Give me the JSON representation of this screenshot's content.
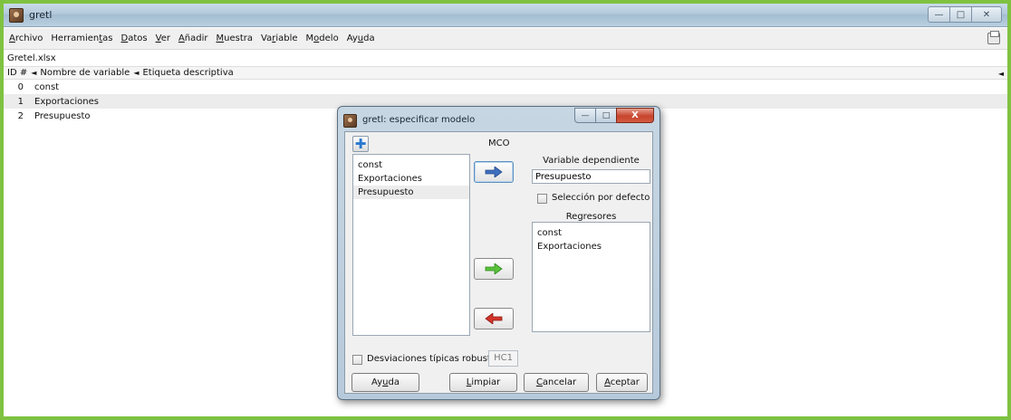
{
  "window": {
    "title": "gretl",
    "controls": {
      "minimize": "—",
      "maximize": "□",
      "close": "✕"
    }
  },
  "menubar": {
    "items": [
      {
        "pre": "",
        "key": "A",
        "post": "rchivo"
      },
      {
        "pre": "Herramien",
        "key": "t",
        "post": "as"
      },
      {
        "pre": "",
        "key": "D",
        "post": "atos"
      },
      {
        "pre": "",
        "key": "V",
        "post": "er"
      },
      {
        "pre": "",
        "key": "A",
        "post": "ñadir"
      },
      {
        "pre": "",
        "key": "M",
        "post": "uestra"
      },
      {
        "pre": "Va",
        "key": "r",
        "post": "iable"
      },
      {
        "pre": "M",
        "key": "o",
        "post": "delo"
      },
      {
        "pre": "Ay",
        "key": "u",
        "post": "da"
      }
    ]
  },
  "file": {
    "name": "Gretel.xlsx"
  },
  "table": {
    "headers": {
      "id": "ID #",
      "name": "Nombre de variable",
      "label": "Etiqueta descriptiva"
    },
    "rows": [
      {
        "id": "0",
        "name": "const"
      },
      {
        "id": "1",
        "name": "Exportaciones"
      },
      {
        "id": "2",
        "name": "Presupuesto"
      }
    ]
  },
  "dialog": {
    "title": "gretl: especificar modelo",
    "controls": {
      "minimize": "—",
      "maximize": "□",
      "close": "X"
    },
    "method": "MCO",
    "available_vars": [
      "const",
      "Exportaciones",
      "Presupuesto"
    ],
    "dependent_label": "Variable dependiente",
    "dependent_value": "Presupuesto",
    "default_selection_label": "Selección por defecto",
    "regressors_label": "Regresores",
    "regressors": [
      "const",
      "Exportaciones"
    ],
    "robust_label": "Desviaciones típicas robustas",
    "robust_value": "HC1",
    "buttons": {
      "help": {
        "pre": "Ay",
        "key": "u",
        "post": "da"
      },
      "clear": {
        "pre": "",
        "key": "L",
        "post": "impiar"
      },
      "cancel": {
        "pre": "",
        "key": "C",
        "post": "ancelar"
      },
      "accept": {
        "pre": "",
        "key": "A",
        "post": "ceptar"
      }
    },
    "colors": {
      "arrow_blue": "#3f6fbf",
      "arrow_green": "#59c23a",
      "arrow_red": "#d2342a"
    }
  }
}
